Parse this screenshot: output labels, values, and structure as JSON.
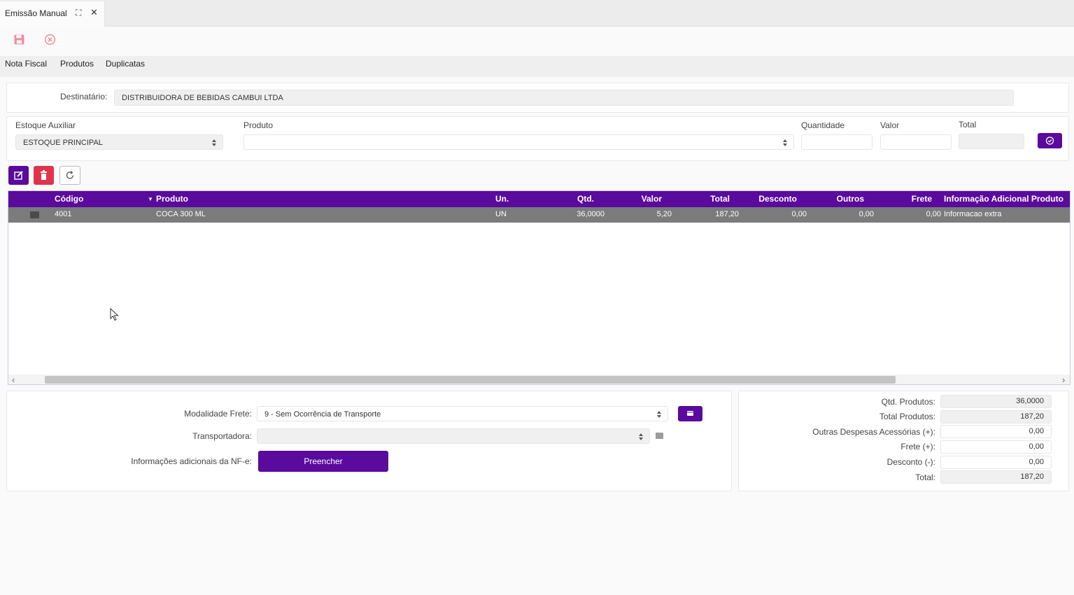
{
  "tab": {
    "title": "Emissão Manual",
    "maximize_icon": "⛶",
    "close_icon": "✕"
  },
  "toolbar": {
    "save_icon": "save-icon",
    "cancel_icon": "cancel-icon"
  },
  "subtabs": [
    "Nota Fiscal",
    "Produtos",
    "Duplicatas"
  ],
  "destinatario": {
    "label": "Destinatário:",
    "value": "DISTRIBUIDORA DE BEBIDAS CAMBUI LTDA"
  },
  "entry": {
    "estoque_label": "Estoque Auxiliar",
    "estoque_value": "ESTOQUE PRINCIPAL",
    "produto_label": "Produto",
    "produto_value": "",
    "quantidade_label": "Quantidade",
    "quantidade_value": "",
    "valor_label": "Valor",
    "valor_value": "",
    "total_label": "Total",
    "total_value": ""
  },
  "grid": {
    "columns": [
      "Código",
      "Produto",
      "Un.",
      "Qtd.",
      "Valor",
      "Total",
      "Desconto",
      "Outros",
      "Frete",
      "Informação Adicional Produto"
    ],
    "sort_icon": "▼",
    "rows": [
      {
        "codigo": "4001",
        "produto": "COCA 300 ML",
        "un": "UN",
        "qtd": "36,0000",
        "valor": "5,20",
        "total": "187,20",
        "desconto": "0,00",
        "outros": "0,00",
        "frete": "0,00",
        "info": "Informacao extra"
      }
    ],
    "scroll_left_icon": "‹",
    "scroll_right_icon": "›"
  },
  "frete": {
    "modalidade_label": "Modalidade Frete:",
    "modalidade_value": "9 - Sem Ocorrência de Transporte",
    "transportadora_label": "Transportadora:",
    "transportadora_value": "",
    "info_label": "Informações adicionais da NF-e:",
    "preencher_label": "Preencher"
  },
  "totals": {
    "qtd_label": "Qtd. Produtos:",
    "qtd_value": "36,0000",
    "total_produtos_label": "Total Produtos:",
    "total_produtos_value": "187,20",
    "outras_label": "Outras Despesas Acessórias (+):",
    "outras_value": "0,00",
    "frete_label": "Frete (+):",
    "frete_value": "0,00",
    "desconto_label": "Desconto (-):",
    "desconto_value": "0,00",
    "total_label": "Total:",
    "total_value": "187,20"
  },
  "colors": {
    "accent": "#5a0a9c",
    "danger": "#e0344c",
    "row_selected": "#7b7b7b"
  }
}
